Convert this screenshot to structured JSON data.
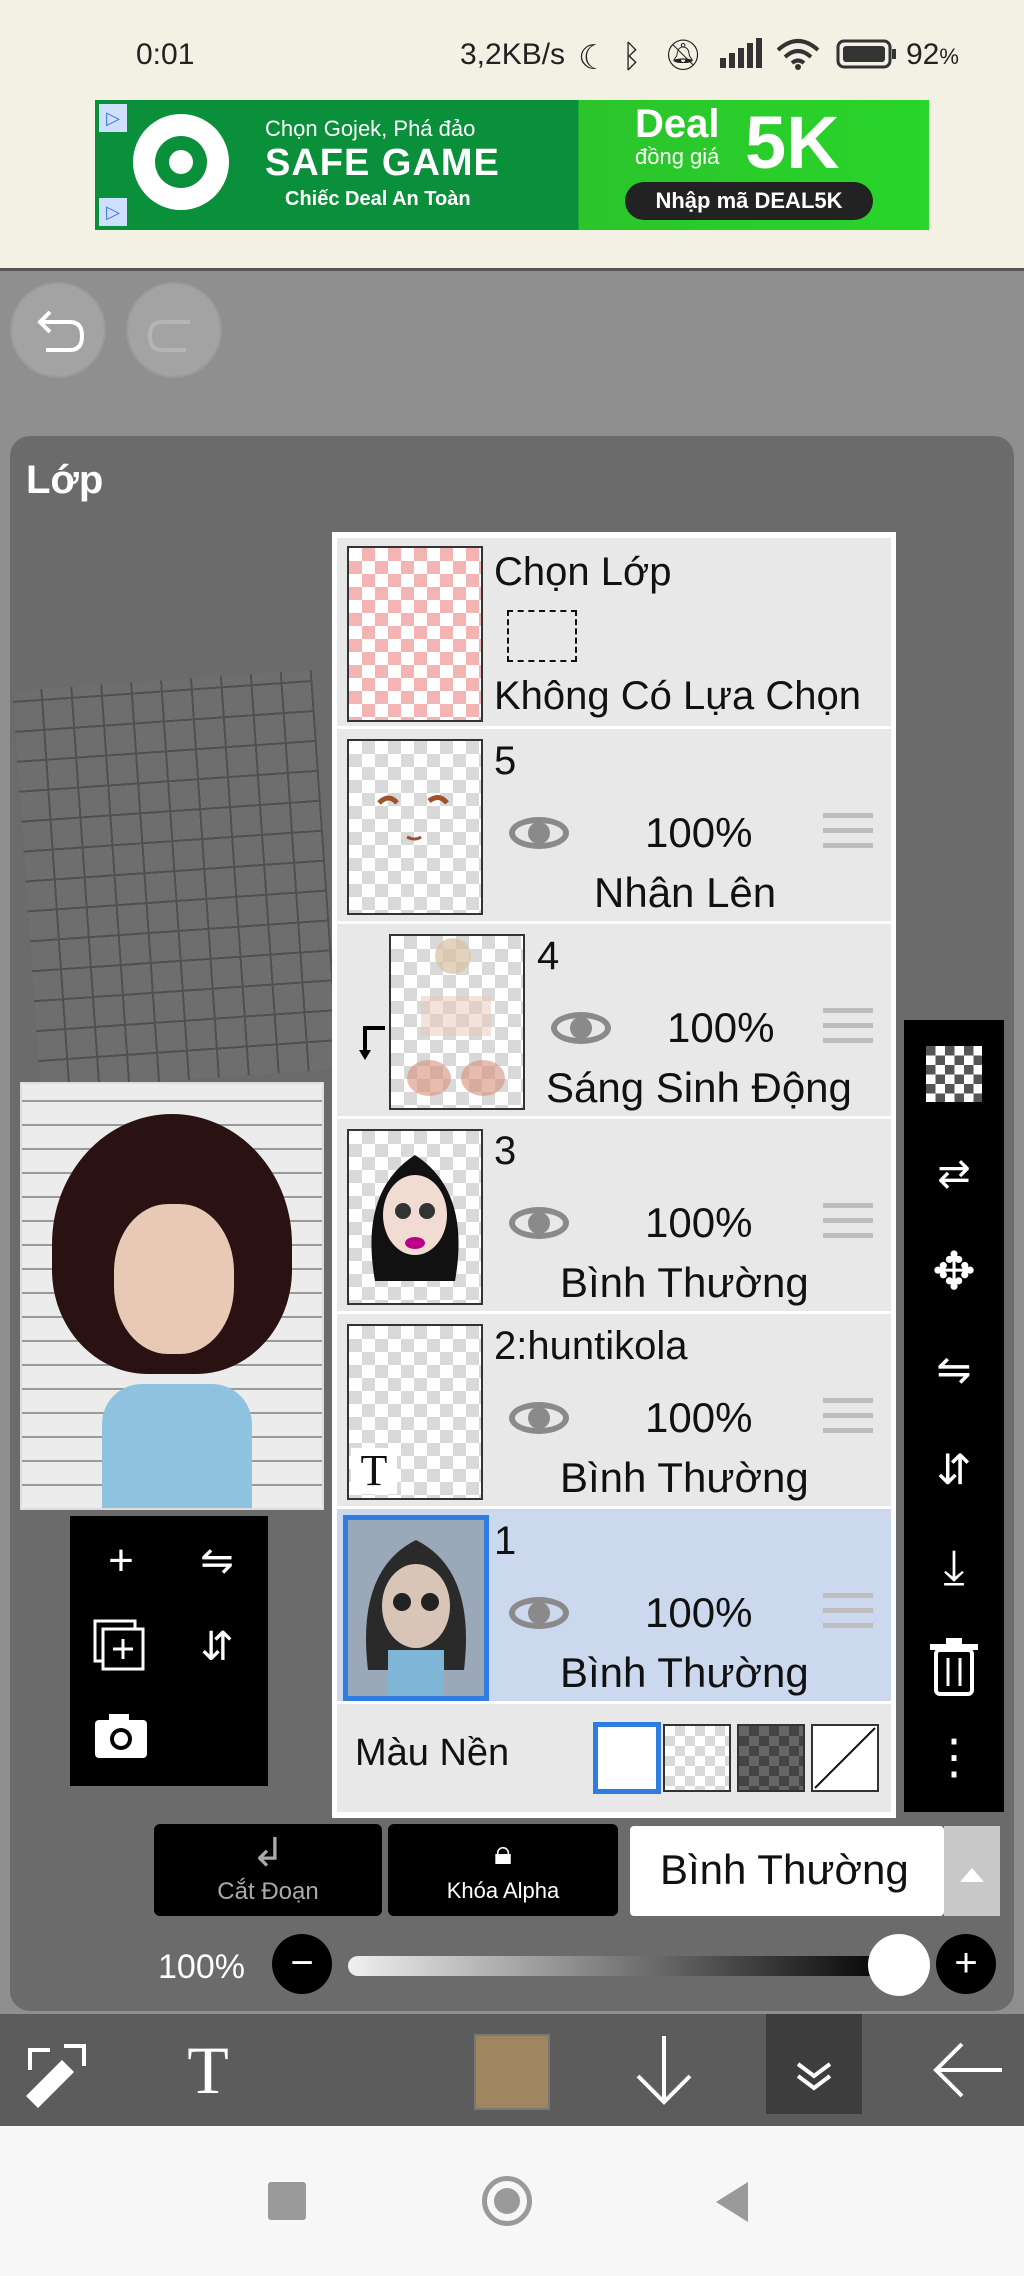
{
  "status_bar": {
    "time": "0:01",
    "net_speed": "3,2KB/s",
    "battery": "92",
    "battery_unit": "%",
    "icons": [
      "moon-icon",
      "bluetooth-icon",
      "mute-icon",
      "signal-icon",
      "wifi-icon",
      "battery-icon"
    ]
  },
  "ad": {
    "line1": "Chọn Gojek, Phá đảo",
    "line2": "SAFE GAME",
    "line3": "Chiếc Deal An Toàn",
    "deal_word": "Deal",
    "deal_sub": "đồng giá",
    "deal_value": "5K",
    "code": "Nhập mã DEAL5K"
  },
  "panel": {
    "title": "Lớp"
  },
  "layers": {
    "select_layer": {
      "title": "Chọn Lớp",
      "subtitle": "Không Có Lựa Chọn"
    },
    "items": [
      {
        "name": "5",
        "opacity": "100%",
        "blend": "Nhân Lên"
      },
      {
        "name": "4",
        "opacity": "100%",
        "blend": "Sáng Sinh Động"
      },
      {
        "name": "3",
        "opacity": "100%",
        "blend": "Bình Thường"
      },
      {
        "name": "2:huntikola",
        "opacity": "100%",
        "blend": "Bình Thường"
      },
      {
        "name": "1",
        "opacity": "100%",
        "blend": "Bình Thường"
      }
    ],
    "background_label": "Màu Nền",
    "text_glyph": "T"
  },
  "controls": {
    "clip_label": "Cắt Đoạn",
    "alpha_lock_label": "Khóa Alpha",
    "blend_mode": "Bình Thường",
    "opacity_value": "100%",
    "minus": "−",
    "plus": "+"
  },
  "bottom_toolbar": {
    "text_tool": "T"
  },
  "colors": {
    "current_color": "#a08660",
    "selected_layer": "#cbd8ee",
    "accent": "#2f7de1"
  }
}
